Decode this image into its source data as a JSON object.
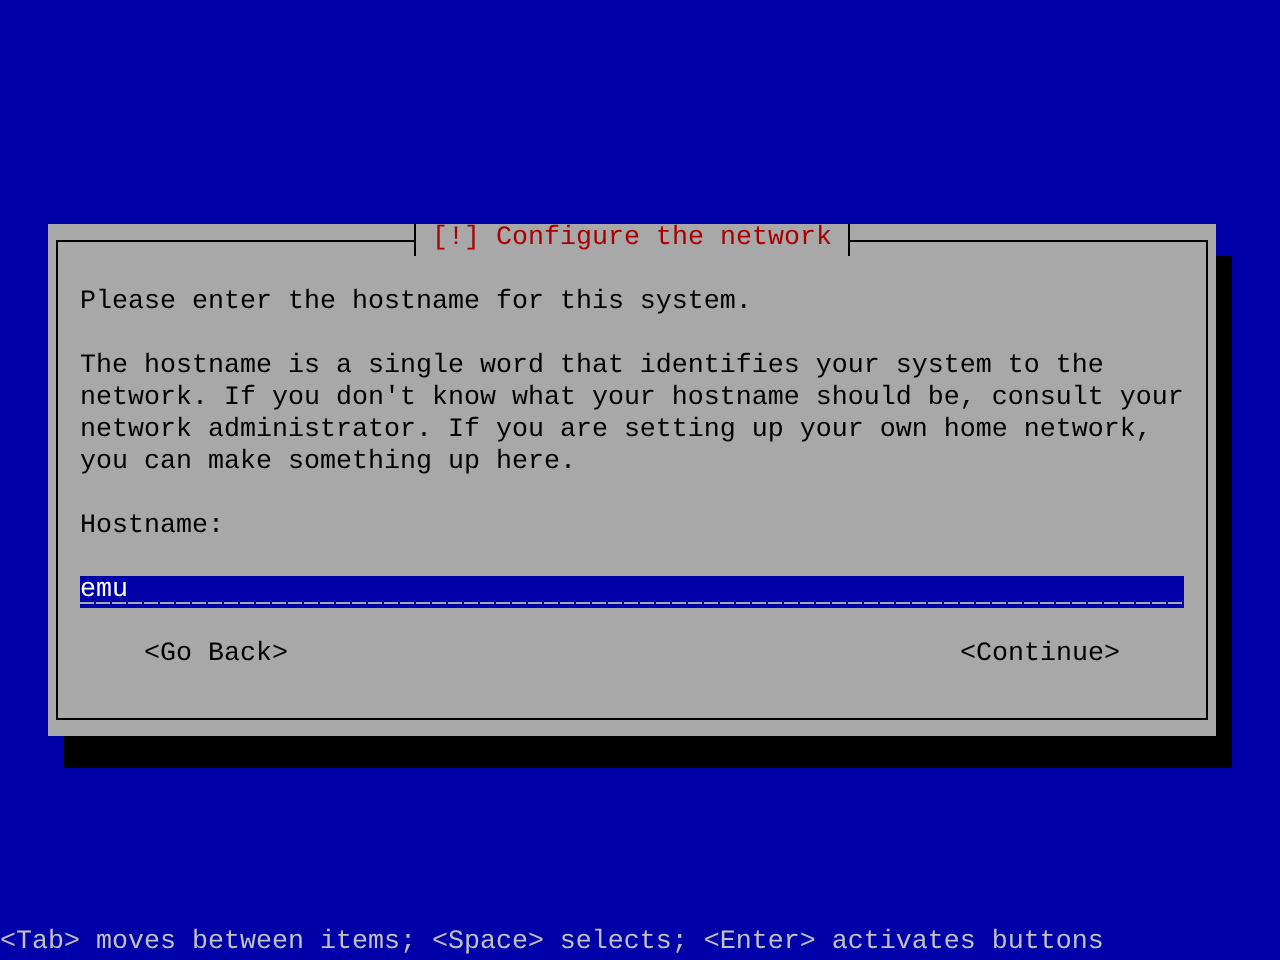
{
  "dialog": {
    "title": "[!] Configure the network",
    "prompt": "Please enter the hostname for this system.",
    "description": "The hostname is a single word that identifies your system to the network. If you don't know what your hostname should be, consult your network administrator. If you are setting up your own home network, you can make something up here.",
    "field_label": "Hostname:",
    "field": {
      "value": "emu"
    },
    "buttons": [
      "<Go Back>",
      "<Continue>"
    ]
  },
  "status_bar": "<Tab> moves between items; <Space> selects; <Enter> activates buttons"
}
